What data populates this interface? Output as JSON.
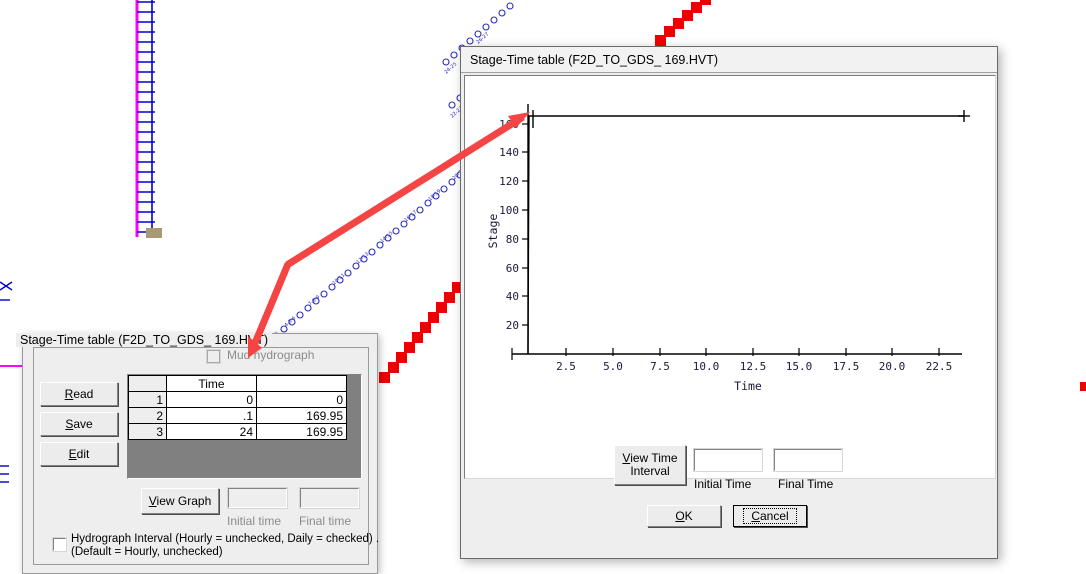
{
  "background": {
    "description": "CAD canvas with cross-section schematic lines behind the dialogs",
    "colors": {
      "magenta_line": "#ff00ff",
      "blue_elements": "#0000cc",
      "red_squares": "#ee0000",
      "annotation_arrow": "#f44444"
    }
  },
  "left_dialog": {
    "title": "Stage-Time table (F2D_TO_GDS_ 169.HVT)",
    "mud_hydrograph": {
      "label": "Mud hydrograph",
      "checked": false,
      "enabled": false
    },
    "buttons": {
      "read": "Read",
      "save": "Save",
      "edit": "Edit",
      "view_graph": "View Graph"
    },
    "table": {
      "columns": [
        "",
        "Time",
        ""
      ],
      "rows": [
        {
          "n": "1",
          "time": "0",
          "value": "0"
        },
        {
          "n": "2",
          "time": ".1",
          "value": "169.95"
        },
        {
          "n": "3",
          "time": "24",
          "value": "169.95"
        }
      ]
    },
    "initial_time": {
      "label": "Initial time",
      "value": ""
    },
    "final_time": {
      "label": "Final time",
      "value": ""
    },
    "hydrograph_interval": {
      "line1": "Hydrograph Interval (Hourly = unchecked, Daily = checked) .",
      "line2": "(Default = Hourly, unchecked)",
      "checked": false
    }
  },
  "right_dialog": {
    "title": "Stage-Time table (F2D_TO_GDS_ 169.HVT)",
    "buttons": {
      "view_time_interval_line1": "View Time",
      "view_time_interval_line2": "Interval",
      "ok": "OK",
      "cancel": "Cancel",
      "focused": "Cancel"
    },
    "initial_time": {
      "label": "Initial Time",
      "value": ""
    },
    "final_time": {
      "label": "Final Time",
      "value": ""
    }
  },
  "chart_data": {
    "type": "line",
    "title": "",
    "xlabel": "Time",
    "ylabel": "Stage",
    "xlim": [
      0,
      24
    ],
    "ylim": [
      0,
      175
    ],
    "xticks": [
      2.5,
      5.0,
      7.5,
      10.0,
      12.5,
      15.0,
      17.5,
      20.0,
      22.5
    ],
    "xticklabels": [
      "2.5",
      "5.0",
      "7.5",
      "10.0",
      "12.5",
      "15.0",
      "17.5",
      "20.0",
      "22.5"
    ],
    "yticks": [
      20,
      40,
      60,
      80,
      100,
      120,
      140,
      160
    ],
    "yticklabels": [
      "20",
      "40",
      "60",
      "80",
      "100",
      "120",
      "140",
      "160"
    ],
    "grid": false,
    "legend": false,
    "series": [
      {
        "name": "Stage",
        "x": [
          0,
          0.1,
          24
        ],
        "y": [
          0,
          169.95,
          169.95
        ],
        "color": "#000000",
        "marker": "plus"
      }
    ]
  }
}
